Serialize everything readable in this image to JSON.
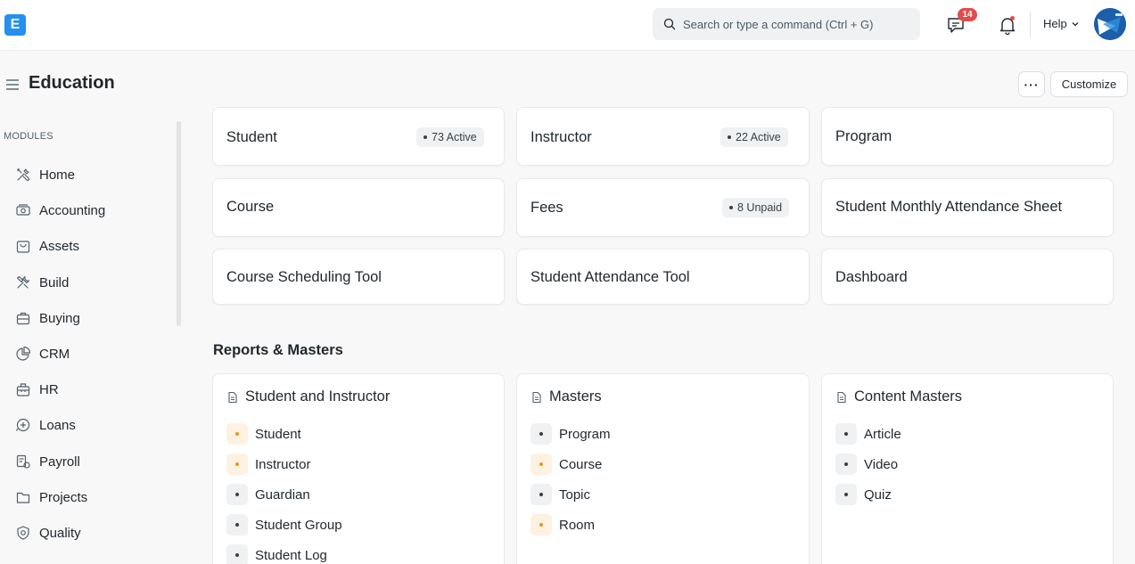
{
  "navbar": {
    "logo_letter": "E",
    "search_placeholder": "Search or type a command (Ctrl + G)",
    "notification_count": "14",
    "help_label": "Help"
  },
  "page": {
    "title": "Education",
    "more_label": "···",
    "customize_label": "Customize"
  },
  "sidebar": {
    "heading": "MODULES",
    "items": [
      {
        "label": "Home",
        "icon": "tools-icon"
      },
      {
        "label": "Accounting",
        "icon": "money-icon"
      },
      {
        "label": "Assets",
        "icon": "bag-icon"
      },
      {
        "label": "Build",
        "icon": "wrench-icon"
      },
      {
        "label": "Buying",
        "icon": "briefcase-icon"
      },
      {
        "label": "CRM",
        "icon": "pie-chart-icon"
      },
      {
        "label": "HR",
        "icon": "toolbox-icon"
      },
      {
        "label": "Loans",
        "icon": "loan-icon"
      },
      {
        "label": "Payroll",
        "icon": "payroll-icon"
      },
      {
        "label": "Projects",
        "icon": "folder-icon"
      },
      {
        "label": "Quality",
        "icon": "shield-icon"
      }
    ]
  },
  "shortcuts": [
    {
      "label": "Student",
      "badge": "73 Active"
    },
    {
      "label": "Instructor",
      "badge": "22 Active"
    },
    {
      "label": "Program",
      "badge": ""
    },
    {
      "label": "Course",
      "badge": ""
    },
    {
      "label": "Fees",
      "badge": "8 Unpaid"
    },
    {
      "label": "Student Monthly Attendance Sheet",
      "badge": ""
    },
    {
      "label": "Course Scheduling Tool",
      "badge": ""
    },
    {
      "label": "Student Attendance Tool",
      "badge": ""
    },
    {
      "label": "Dashboard",
      "badge": ""
    }
  ],
  "reports_section_title": "Reports & Masters",
  "report_cards": [
    {
      "title": "Student and Instructor",
      "links": [
        {
          "label": "Student",
          "status": "warning"
        },
        {
          "label": "Instructor",
          "status": "warning"
        },
        {
          "label": "Guardian",
          "status": "default"
        },
        {
          "label": "Student Group",
          "status": "default"
        },
        {
          "label": "Student Log",
          "status": "default"
        }
      ]
    },
    {
      "title": "Masters",
      "links": [
        {
          "label": "Program",
          "status": "default"
        },
        {
          "label": "Course",
          "status": "warning"
        },
        {
          "label": "Topic",
          "status": "default"
        },
        {
          "label": "Room",
          "status": "warning"
        }
      ]
    },
    {
      "title": "Content Masters",
      "links": [
        {
          "label": "Article",
          "status": "default"
        },
        {
          "label": "Video",
          "status": "default"
        },
        {
          "label": "Quiz",
          "status": "default"
        }
      ]
    }
  ],
  "colors": {
    "brand": "#2490ef",
    "badge_red": "#e24c4c",
    "warning_dot": "#e79913"
  }
}
